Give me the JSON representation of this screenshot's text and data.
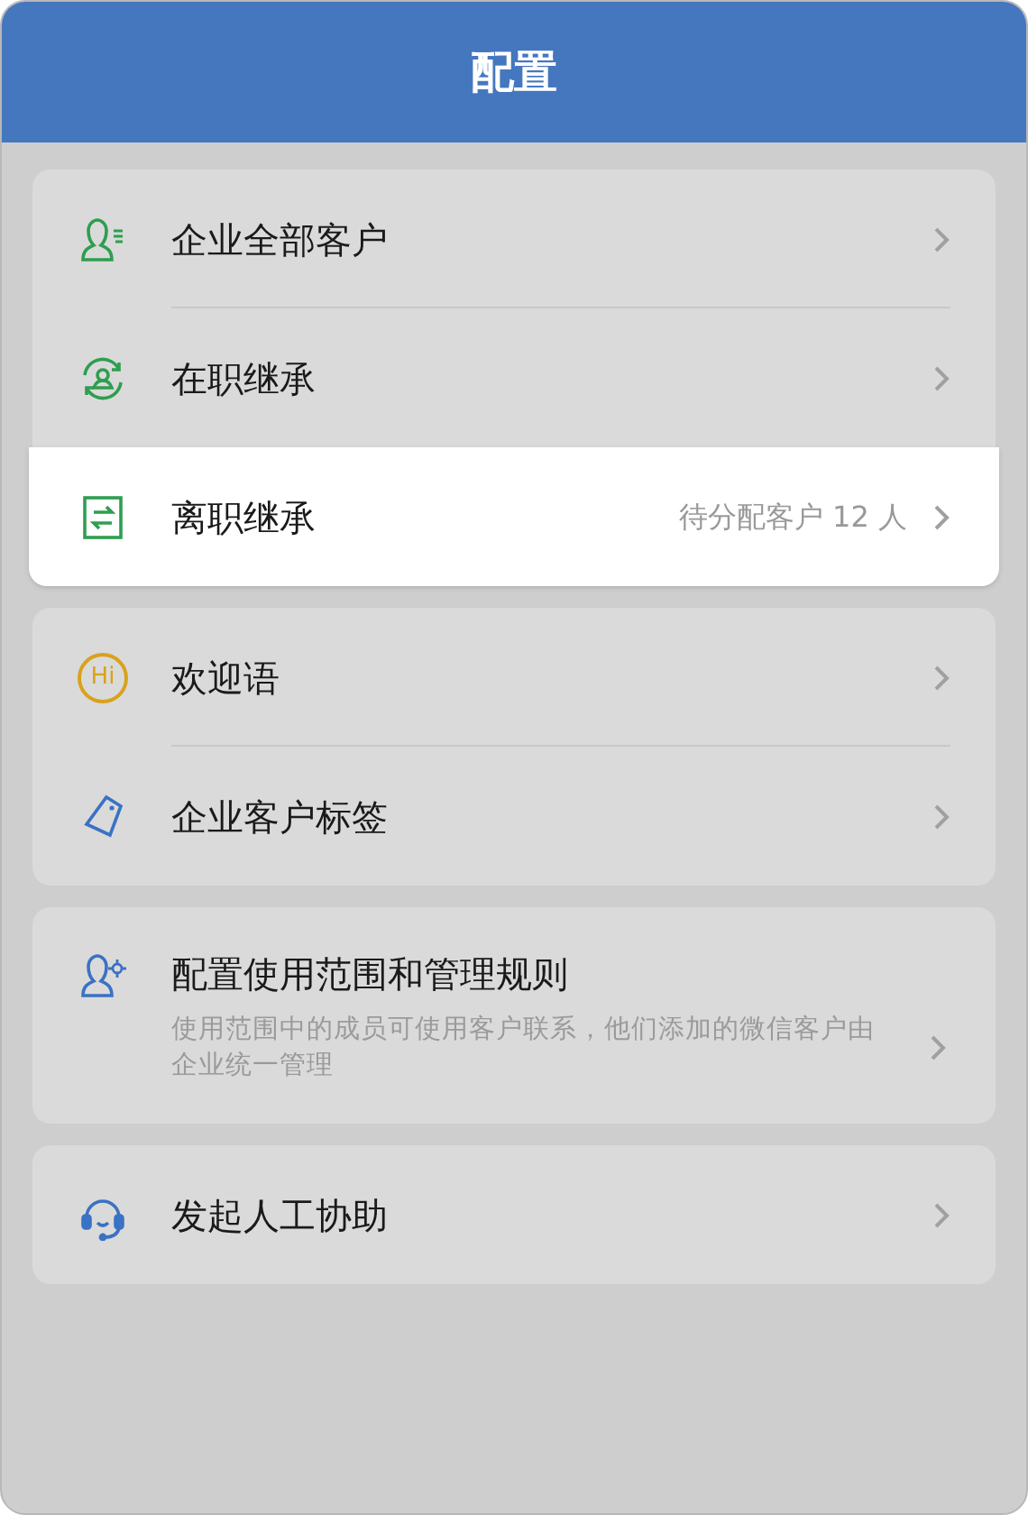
{
  "header": {
    "title": "配置"
  },
  "groups": [
    {
      "items": [
        {
          "kind": "person-list",
          "label": "企业全部客户",
          "selected": false
        },
        {
          "kind": "person-cycle",
          "label": "在职继承",
          "selected": false
        },
        {
          "kind": "transfer",
          "label": "离职继承",
          "hint": "待分配客户 12 人",
          "selected": true
        }
      ]
    },
    {
      "items": [
        {
          "kind": "hi",
          "icon_text": "Hi",
          "label": "欢迎语",
          "selected": false
        },
        {
          "kind": "tag",
          "label": "企业客户标签",
          "selected": false
        }
      ]
    },
    {
      "items": [
        {
          "kind": "person-gear",
          "label": "配置使用范围和管理规则",
          "description": "使用范围中的成员可使用客户联系，他们添加的微信客户由企业统一管理",
          "selected": false
        }
      ]
    },
    {
      "items": [
        {
          "kind": "headset",
          "label": "发起人工协助",
          "selected": false
        }
      ]
    }
  ]
}
